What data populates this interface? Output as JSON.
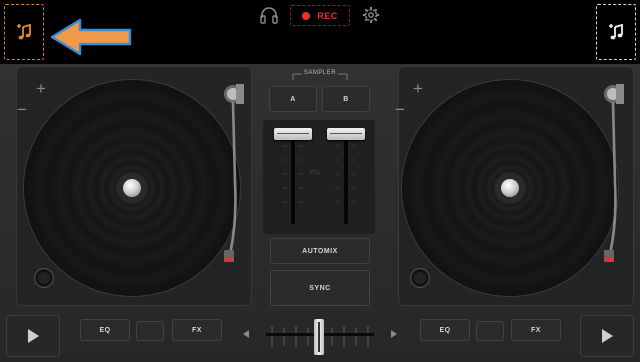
{
  "top_bar": {
    "rec_label": "REC",
    "icons": {
      "left_library": "music-note-add-icon",
      "right_library": "music-note-add-icon",
      "headphones": "headphones-icon",
      "settings": "gear-icon",
      "annotation": "arrow-left-icon"
    }
  },
  "deck_left": {
    "zoom_in": "+",
    "zoom_out": "−"
  },
  "deck_right": {
    "zoom_in": "+",
    "zoom_out": "−"
  },
  "sampler": {
    "label": "SAMPLER",
    "pad_a": "A",
    "pad_b": "B"
  },
  "mixer": {
    "volume_label": "VOL",
    "automix_label": "AUTOMIX",
    "sync_label": "SYNC",
    "left_volume_pct": 100,
    "right_volume_pct": 100,
    "crossfader_pct": 50
  },
  "bottom_left": {
    "eq_label": "EQ",
    "fx_label": "FX"
  },
  "bottom_right": {
    "eq_label": "EQ",
    "fx_label": "FX"
  },
  "colors": {
    "accent_orange": "#d8822a",
    "record_red": "#e8332a",
    "annotation_arrow": "#f39a4a",
    "annotation_outline": "#3a8ddb"
  }
}
